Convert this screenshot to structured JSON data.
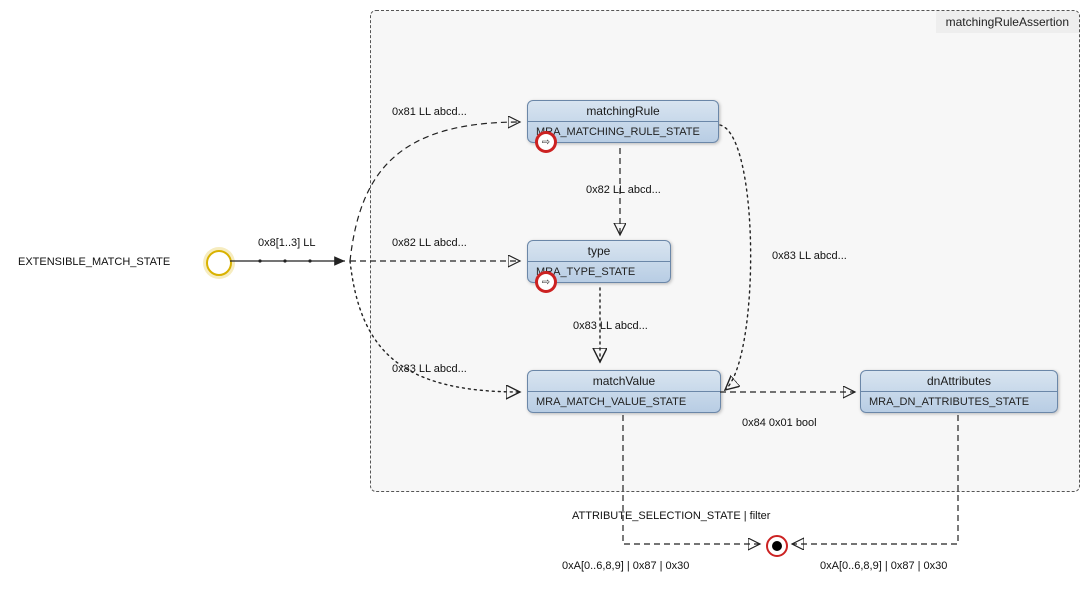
{
  "container": {
    "title": "matchingRuleAssertion"
  },
  "startLabel": "EXTENSIBLE_MATCH_STATE",
  "nodes": {
    "matchingRule": {
      "title": "matchingRule",
      "body": "MRA_MATCHING_RULE_STATE"
    },
    "type": {
      "title": "type",
      "body": "MRA_TYPE_STATE"
    },
    "matchValue": {
      "title": "matchValue",
      "body": "MRA_MATCH_VALUE_STATE"
    },
    "dnAttributes": {
      "title": "dnAttributes",
      "body": "MRA_DN_ATTRIBUTES_STATE"
    }
  },
  "edgeLabels": {
    "forkIn": "0x8[1..3] LL",
    "e81": "0x81 LL abcd...",
    "e82_top": "0x82 LL abcd...",
    "e82_mid": "0x82 LL abcd...",
    "e83_top": "0x83 LL abcd...",
    "e83_mid": "0x83 LL abcd...",
    "e83_bottom": "0x83 LL abcd...",
    "e84": "0x84 0x01 bool",
    "exitTitle": "ATTRIBUTE_SELECTION_STATE | filter",
    "exitCodeL": "0xA[0..6,8,9] | 0x87 | 0x30",
    "exitCodeR": "0xA[0..6,8,9] | 0x87 | 0x30"
  }
}
